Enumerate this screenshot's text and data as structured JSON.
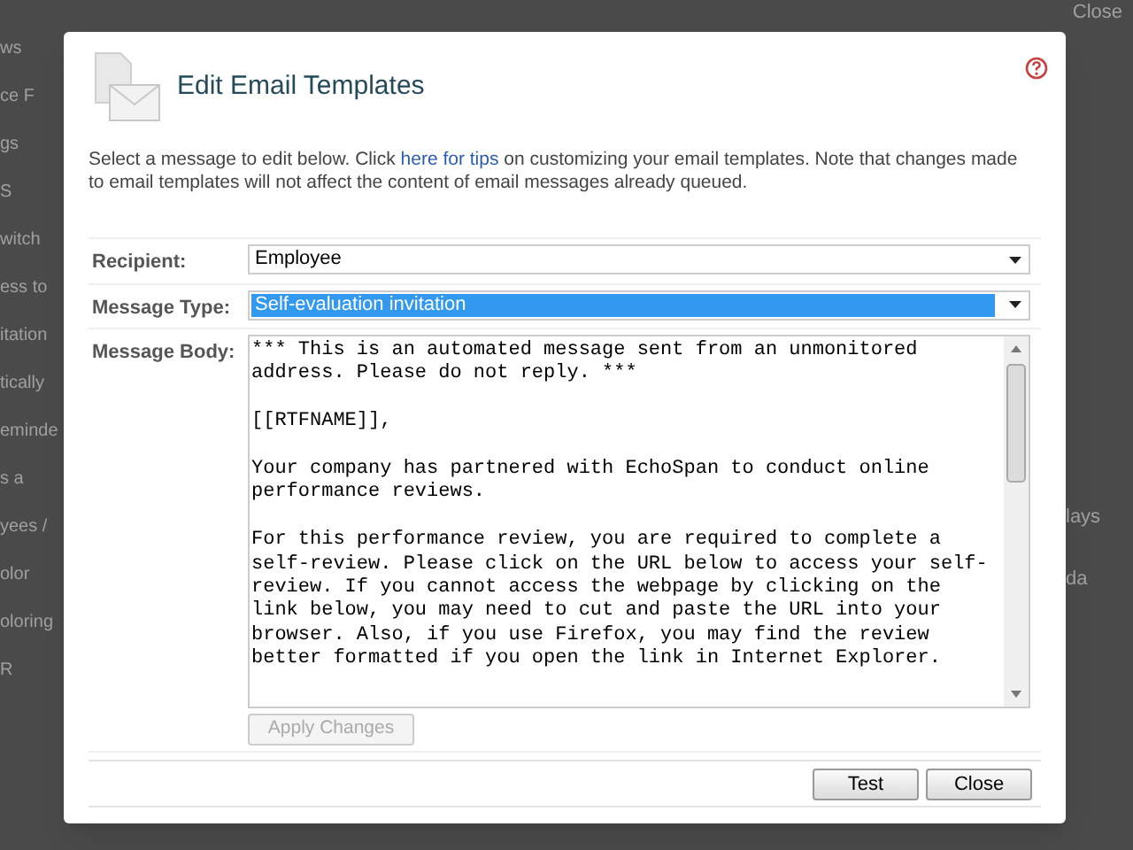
{
  "background": {
    "top_link": "Close",
    "left_fragments": [
      "ws",
      "ce F",
      "gs",
      "S",
      "witch",
      "ess to",
      "itation",
      "tically",
      "eminde",
      "s a",
      "yees /",
      "olor",
      "oloring",
      "R"
    ],
    "right_fragments": [
      "lays",
      "da"
    ]
  },
  "dialog": {
    "title": "Edit Email Templates",
    "intro": {
      "before": "Select a message to edit below. Click",
      "link": "here for tips",
      "after": "on customizing your email templates. Note that changes made to email templates will not affect the content of email messages already queued."
    },
    "fields": [
      {
        "label": "Recipient:",
        "kind": "select",
        "value": "Employee",
        "selected": false
      },
      {
        "label": "Message Type:",
        "kind": "select",
        "value": "Self-evaluation invitation",
        "selected": true
      },
      {
        "label": "Message Body:",
        "kind": "textarea",
        "value": "*** This is an automated message sent from an unmonitored address. Please do not reply. ***\n\n[[RTFNAME]],\n\nYour company has partnered with EchoSpan to conduct online performance reviews.\n\nFor this performance review, you are required to complete a self-review. Please click on the URL below to access your self-review. If you cannot access the webpage by clicking on the link below, you may need to cut and paste the URL into your browser. Also, if you use Firefox, you may find the review better formatted if you open the link in Internet Explorer."
      }
    ],
    "apply_button": {
      "label": "Apply Changes",
      "disabled": true
    },
    "buttons": [
      "Test",
      "Close"
    ]
  }
}
